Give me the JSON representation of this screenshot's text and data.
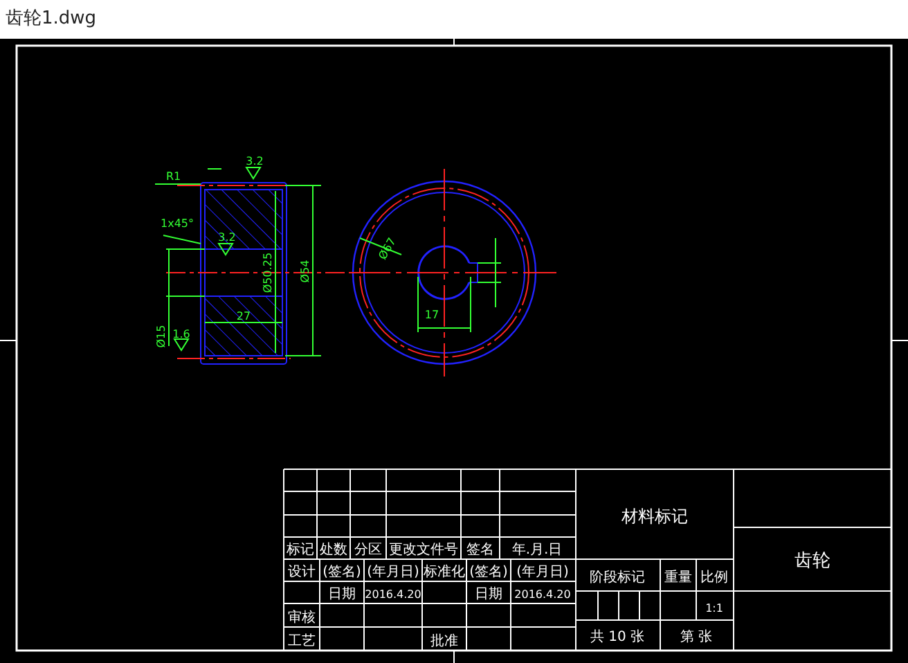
{
  "window": {
    "title": "齿轮1.dwg"
  },
  "side_view": {
    "annotations": [
      "R1",
      "3.2",
      "1x45°",
      "3.2",
      "Ø50.25",
      "Ø54",
      "27",
      "Ø15",
      "1.6"
    ]
  },
  "front_view": {
    "annotations": [
      "Ø67",
      "17"
    ]
  },
  "title_block": {
    "revision_header": [
      "标记",
      "处数",
      "分区",
      "更改文件号",
      "签名",
      "年.月.日"
    ],
    "approval_header": [
      "设计",
      "(签名)",
      "(年月日)",
      "标准化",
      "(签名)",
      "(年月日)"
    ],
    "date_row": [
      "日期",
      "2016.4.20",
      "日期",
      "2016.4.20"
    ],
    "review_label": "审核",
    "process_label": "工艺",
    "approve_label": "批准",
    "material": "材料标记",
    "stage_labels": [
      "阶段标记",
      "重量",
      "比例"
    ],
    "scale": "1:1",
    "sheet_total": "共 10 张",
    "sheet_number": "第 张",
    "part_name": "齿轮"
  }
}
